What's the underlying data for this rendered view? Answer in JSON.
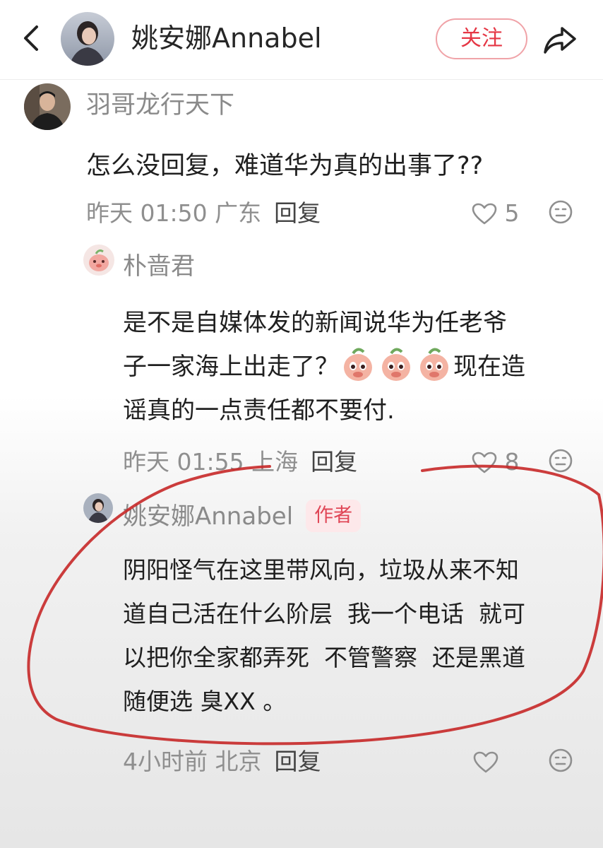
{
  "header": {
    "title": "姚安娜Annabel",
    "follow_label": "关注"
  },
  "comments": [
    {
      "username": "羽哥龙行天下",
      "text": "怎么没回复，难道华为真的出事了??",
      "time_location": "昨天 01:50 广东",
      "reply_label": "回复",
      "likes": "5"
    },
    {
      "username": "朴啬君",
      "text_line1": "是不是自媒体发的新闻说华为任老爷",
      "text_line2": "子一家海上出走了？",
      "text_line2_after": "现在造",
      "text_line3": "谣真的一点责任都不要付.",
      "time_location": "昨天 01:55 上海",
      "reply_label": "回复",
      "likes": "8"
    },
    {
      "username": "姚安娜Annabel",
      "badge": "作者",
      "text_line1": "阴阳怪气在这里带风向，垃圾从来不知",
      "text_line2": "道自己活在什么阶层  我一个电话  就可",
      "text_line3": "以把你全家都弄死  不管警察  还是黑道",
      "text_line4": "随便选 臭XX 。",
      "time_location": "4小时前 北京",
      "reply_label": "回复"
    }
  ],
  "colors": {
    "follow_red": "#e53745",
    "annotation_red": "#c62828",
    "badge_bg": "#fde8ea"
  },
  "icons": [
    "back-arrow-icon",
    "share-icon",
    "heart-icon",
    "emoji-face-icon",
    "peach-emoji-icon"
  ]
}
